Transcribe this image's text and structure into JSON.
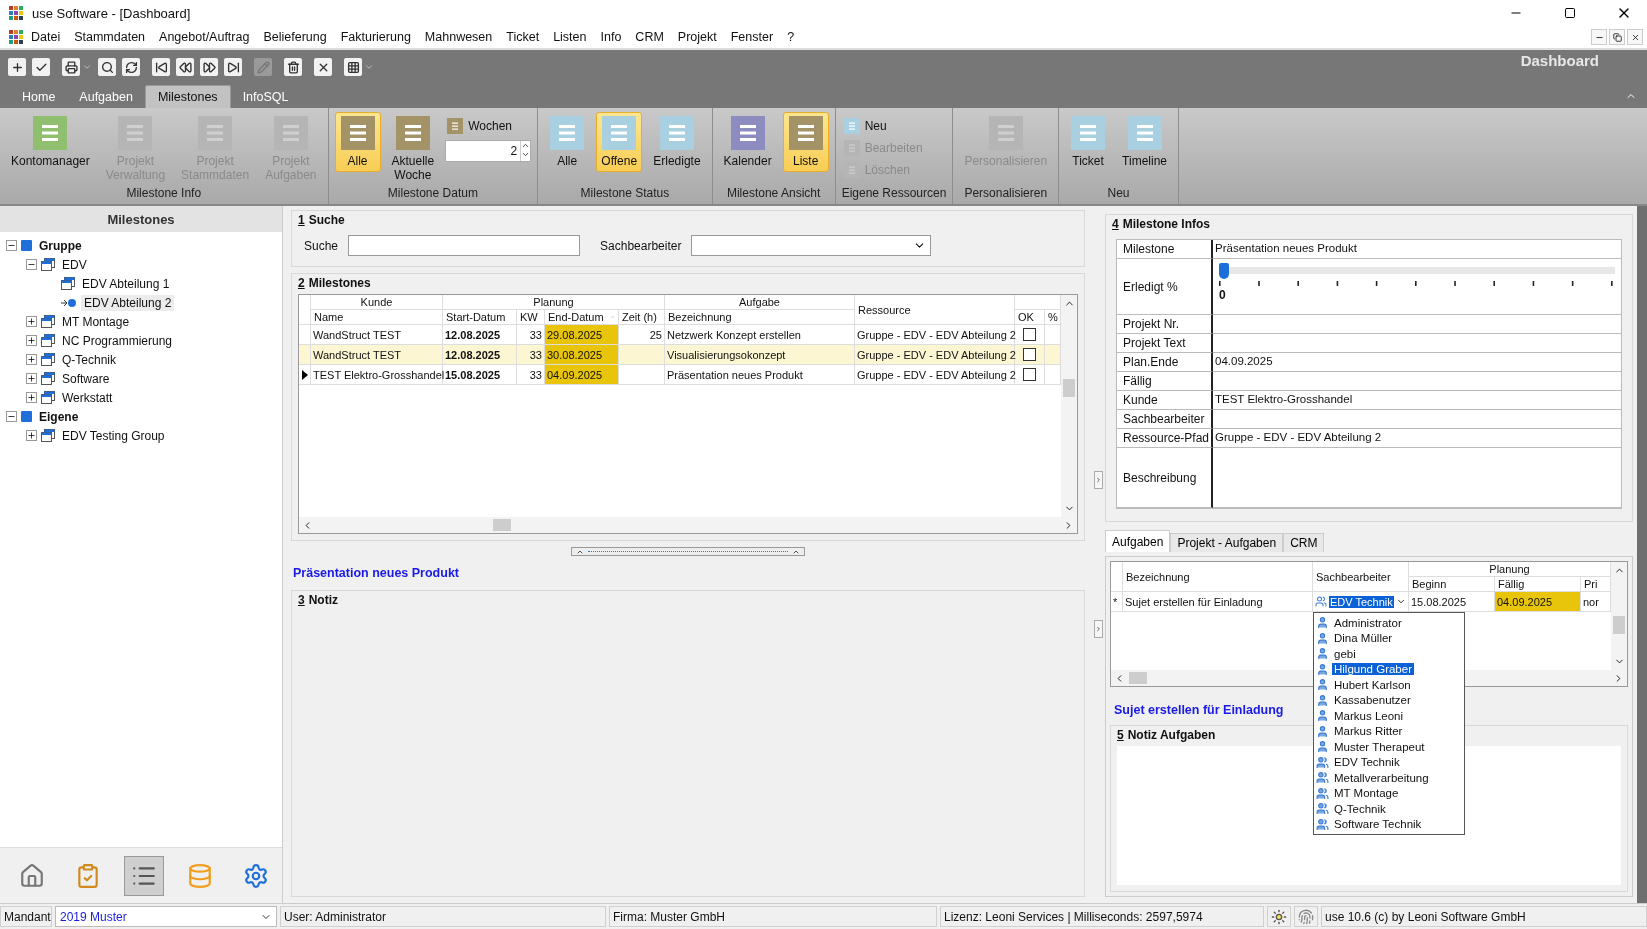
{
  "window": {
    "title": "use Software - [Dashboard]"
  },
  "menu": [
    "Datei",
    "Stammdaten",
    "Angebot/Auftrag",
    "Belieferung",
    "Fakturierung",
    "Mahnwesen",
    "Ticket",
    "Listen",
    "Info",
    "CRM",
    "Projekt",
    "Fenster",
    "?"
  ],
  "toolbar": {
    "caption": "Dashboard",
    "buttons": [
      {
        "disabled": false
      },
      {
        "disabled": false
      },
      {
        "disabled": false,
        "has_menu": true
      },
      {
        "disabled": false
      },
      {
        "disabled": false
      },
      {
        "disabled": false
      },
      {
        "disabled": false
      },
      {
        "disabled": false
      },
      {
        "disabled": false
      },
      {
        "disabled": true
      },
      {
        "disabled": false
      },
      {
        "disabled": false
      },
      {
        "disabled": false,
        "has_menu": true
      }
    ]
  },
  "ribbon_tabs": [
    {
      "label": "Home",
      "selected": false
    },
    {
      "label": "Aufgaben",
      "selected": false
    },
    {
      "label": "Milestones",
      "selected": true
    },
    {
      "label": "InfoSQL",
      "selected": false
    }
  ],
  "ribbon_groups": [
    {
      "title": "Milestone Info",
      "items": [
        {
          "kind": "large",
          "label": "Kontomanager",
          "color": "#8fbf6f",
          "selected": false,
          "disabled": false
        },
        {
          "kind": "large",
          "label": "Projekt Verwaltung",
          "color": "#b5b5b5",
          "selected": false,
          "disabled": true
        },
        {
          "kind": "large",
          "label": "Projekt Stammdaten",
          "color": "#b5b5b5",
          "selected": false,
          "disabled": true
        },
        {
          "kind": "large",
          "label": "Projekt Aufgaben",
          "color": "#b5b5b5",
          "selected": false,
          "disabled": true
        }
      ]
    },
    {
      "title": "Milestone Datum",
      "items": [
        {
          "kind": "large",
          "label": "Alle",
          "color": "#a39366",
          "selected": true,
          "disabled": false
        },
        {
          "kind": "large",
          "label": "Aktuelle Woche",
          "color": "#a39366",
          "selected": false,
          "disabled": false
        },
        {
          "kind": "small",
          "label": "Wochen",
          "color": "#a39366",
          "selected": false,
          "disabled": false
        },
        {
          "kind": "spin",
          "value": "2"
        }
      ]
    },
    {
      "title": "Milestone Status",
      "items": [
        {
          "kind": "large",
          "label": "Alle",
          "color": "#a8d0e0",
          "selected": false,
          "disabled": false
        },
        {
          "kind": "large",
          "label": "Offene",
          "color": "#a8d0e0",
          "selected": true,
          "disabled": false
        },
        {
          "kind": "large",
          "label": "Erledigte",
          "color": "#a8d0e0",
          "selected": false,
          "disabled": false
        }
      ]
    },
    {
      "title": "Milestone Ansicht",
      "items": [
        {
          "kind": "large",
          "label": "Kalender",
          "color": "#8c8cc0",
          "selected": false,
          "disabled": false
        },
        {
          "kind": "large",
          "label": "Liste",
          "color": "#a39366",
          "selected": true,
          "disabled": false
        }
      ]
    },
    {
      "title": "Eigene Ressourcen",
      "items": [
        {
          "kind": "small",
          "label": "Neu",
          "color": "#a8d0e0",
          "selected": false,
          "disabled": false
        },
        {
          "kind": "small",
          "label": "Bearbeiten",
          "color": "#b5b5b5",
          "selected": false,
          "disabled": true
        },
        {
          "kind": "small",
          "label": "Löschen",
          "color": "#b5b5b5",
          "selected": false,
          "disabled": true
        }
      ]
    },
    {
      "title": "Personalisieren",
      "items": [
        {
          "kind": "large",
          "label": "Personalisieren",
          "color": "#b5b5b5",
          "selected": false,
          "disabled": true
        }
      ]
    },
    {
      "title": "Neu",
      "items": [
        {
          "kind": "large",
          "label": "Ticket",
          "color": "#a8d0e0",
          "selected": false,
          "disabled": false
        },
        {
          "kind": "large",
          "label": "Timeline",
          "color": "#a8d0e0",
          "selected": false,
          "disabled": false
        }
      ]
    }
  ],
  "tree_panel": {
    "title": "Milestones",
    "nodes": [
      {
        "label": "Gruppe",
        "kind": "group",
        "expanded": true,
        "selected": false,
        "children": [
          {
            "label": "EDV",
            "kind": "folder",
            "expanded": true,
            "selected": false,
            "children": [
              {
                "label": "EDV Abteilung 1",
                "kind": "leaf",
                "selected": false
              },
              {
                "label": "EDV Abteilung 2",
                "kind": "leaf",
                "selected": true
              }
            ]
          },
          {
            "label": "MT Montage",
            "kind": "folder",
            "expanded": false,
            "selected": false
          },
          {
            "label": "NC Programmierung",
            "kind": "folder",
            "expanded": false,
            "selected": false
          },
          {
            "label": "Q-Technik",
            "kind": "folder",
            "expanded": false,
            "selected": false
          },
          {
            "label": "Software",
            "kind": "folder",
            "expanded": false,
            "selected": false
          },
          {
            "label": "Werkstatt",
            "kind": "folder",
            "expanded": false,
            "selected": false
          }
        ]
      },
      {
        "label": "Eigene",
        "kind": "group",
        "expanded": true,
        "selected": false,
        "children": [
          {
            "label": "EDV Testing Group",
            "kind": "folder",
            "expanded": false,
            "selected": false
          }
        ]
      }
    ],
    "nav": [
      {
        "selected": false
      },
      {
        "selected": false
      },
      {
        "selected": true
      },
      {
        "selected": false
      },
      {
        "selected": false
      }
    ]
  },
  "search": {
    "number": "1",
    "title": "Suche",
    "fields": [
      {
        "label": "Suche",
        "kind": "text"
      },
      {
        "label": "Sachbearbeiter",
        "kind": "select"
      }
    ]
  },
  "milestones": {
    "number": "2",
    "title": "Milestones",
    "groups": [
      {
        "label": "Kunde",
        "columns": [
          {
            "label": "Name"
          }
        ]
      },
      {
        "label": "Planung",
        "columns": [
          {
            "label": "Start-Datum"
          },
          {
            "label": "KW"
          },
          {
            "label": "End-Datum",
            "sorted": true
          },
          {
            "label": "Zeit (h)"
          }
        ]
      },
      {
        "label": "Aufgabe",
        "columns": [
          {
            "label": "Bezeichnung"
          }
        ]
      },
      {
        "label": "Ressource"
      },
      {
        "columns": [
          {
            "label": "OK"
          },
          {
            "label": "%"
          }
        ]
      }
    ],
    "rows": [
      {
        "name": "WandStruct TEST",
        "start": "12.08.2025",
        "kw": "33",
        "end": "29.08.2025",
        "zeit": "25",
        "bezeichnung": "Netzwerk Konzept erstellen",
        "ressource": "Gruppe - EDV - EDV Abteilung 2",
        "ok": false,
        "selected": false,
        "current": false
      },
      {
        "name": "WandStruct TEST",
        "start": "12.08.2025",
        "kw": "33",
        "end": "30.08.2025",
        "bezeichnung": "Visualisierungsokonzept",
        "ressource": "Gruppe - EDV - EDV Abteilung 2",
        "ok": false,
        "selected": true,
        "current": false
      },
      {
        "name": "TEST Elektro-Grosshandel",
        "start": "15.08.2025",
        "kw": "33",
        "end": "04.09.2025",
        "bezeichnung": "Präsentation neues Produkt",
        "ressource": "Gruppe - EDV - EDV Abteilung 2",
        "ok": false,
        "selected": false,
        "current": true
      }
    ],
    "link": "Präsentation neues Produkt"
  },
  "notiz": {
    "number": "3",
    "title": "Notiz"
  },
  "infos": {
    "number": "4",
    "title": "Milestone Infos",
    "fields": [
      {
        "label": "Milestone",
        "kind": "text",
        "value": "Präsentation neues Produkt"
      },
      {
        "label": "Erledigt %",
        "kind": "slider",
        "level": 0,
        "reading": "0"
      },
      {
        "label": "Projekt Nr.",
        "kind": "text"
      },
      {
        "label": "Projekt Text",
        "kind": "text"
      },
      {
        "label": "Plan.Ende",
        "kind": "text",
        "value": "04.09.2025"
      },
      {
        "label": "Fällig",
        "kind": "text"
      },
      {
        "label": "Kunde",
        "kind": "text",
        "value": "TEST Elektro-Grosshandel"
      },
      {
        "label": "Sachbearbeiter",
        "kind": "text"
      },
      {
        "label": "Ressource-Pfad",
        "kind": "text",
        "value": "Gruppe - EDV - EDV Abteilung 2"
      },
      {
        "label": "Beschreibung",
        "kind": "memo"
      }
    ]
  },
  "task_tabs": [
    {
      "label": "Aufgaben",
      "selected": true
    },
    {
      "label": "Projekt - Aufgaben",
      "selected": false
    },
    {
      "label": "CRM",
      "selected": false
    }
  ],
  "tasks": {
    "groups": [
      {
        "label": "Bezeichnung"
      },
      {
        "label": "Sachbearbeiter"
      },
      {
        "label": "Planung",
        "columns": [
          {
            "label": "Beginn"
          },
          {
            "label": "Fällig"
          },
          {
            "label": "Pri"
          }
        ]
      }
    ],
    "rows": [
      {
        "marker": "*",
        "bezeichnung": "Sujet erstellen für Einladung",
        "assignee": {
          "value": "EDV Technik",
          "highlighted": true
        },
        "beginn": "15.08.2025",
        "faellig": "04.09.2025",
        "pri": "nor"
      }
    ],
    "dropdown": [
      {
        "label": "Administrator",
        "kind": "user",
        "selected": false
      },
      {
        "label": "Dina Müller",
        "kind": "user",
        "selected": false
      },
      {
        "label": "gebi",
        "kind": "user",
        "selected": false
      },
      {
        "label": "Hilgund Graber",
        "kind": "user",
        "selected": true
      },
      {
        "label": "Hubert Karlson",
        "kind": "user",
        "selected": false
      },
      {
        "label": "Kassabenutzer",
        "kind": "user",
        "selected": false
      },
      {
        "label": "Markus Leoni",
        "kind": "user",
        "selected": false
      },
      {
        "label": "Markus Ritter",
        "kind": "user",
        "selected": false
      },
      {
        "label": "Muster Therapeut",
        "kind": "user",
        "selected": false
      },
      {
        "label": "EDV Technik",
        "kind": "group",
        "selected": false
      },
      {
        "label": "Metallverarbeitung",
        "kind": "group",
        "selected": false
      },
      {
        "label": "MT Montage",
        "kind": "group",
        "selected": false
      },
      {
        "label": "Q-Technik",
        "kind": "group",
        "selected": false
      },
      {
        "label": "Software Technik",
        "kind": "group",
        "selected": false
      }
    ],
    "link": "Sujet erstellen für Einladung"
  },
  "task_notiz": {
    "number": "5",
    "title": "Notiz Aufgaben"
  },
  "status_bar": {
    "mandant_label": "Mandant",
    "mandant": "2019 Muster",
    "user": "User: Administrator",
    "firma": "Firma: Muster GmbH",
    "lizenz": "Lizenz: Leoni Services | Milliseconds: 2597,5974",
    "version": "use 10.6 (c) by Leoni Software GmbH"
  }
}
